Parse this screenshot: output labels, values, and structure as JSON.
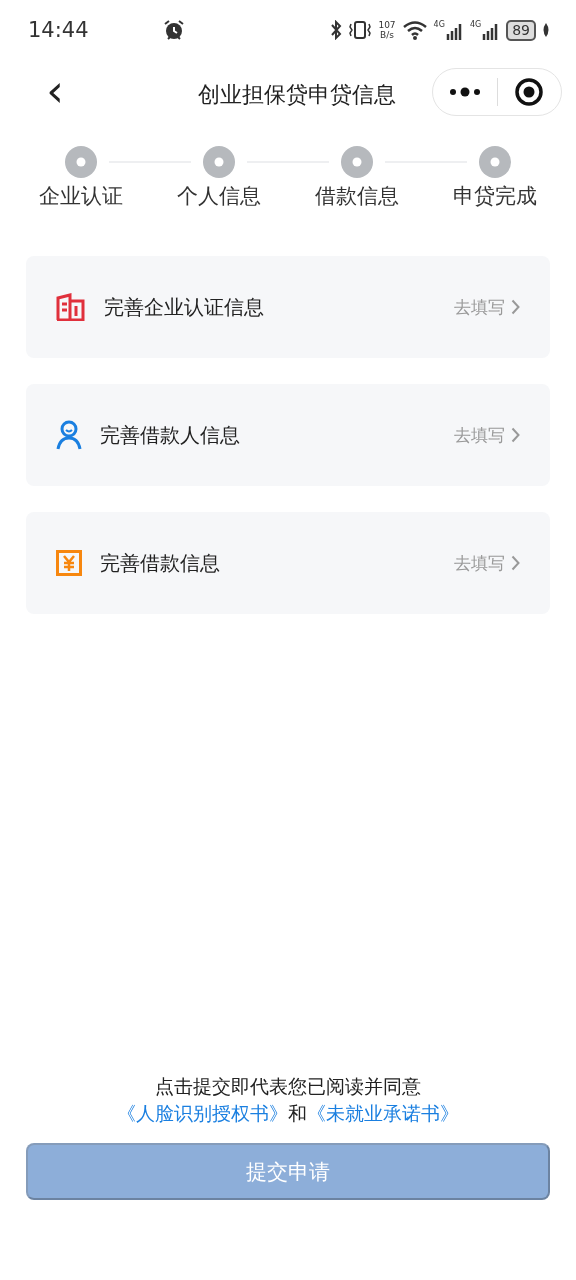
{
  "status_bar": {
    "time": "14:44",
    "net_speed_value": "107",
    "net_speed_unit": "B/s",
    "sim_1": "4G",
    "sim_2": "4G",
    "battery": "89"
  },
  "header": {
    "back": "‹",
    "title": "创业担保贷申贷信息"
  },
  "steps": [
    {
      "label": "企业认证"
    },
    {
      "label": "个人信息"
    },
    {
      "label": "借款信息"
    },
    {
      "label": "申贷完成"
    }
  ],
  "cards": [
    {
      "kind": "building",
      "title": "完善企业认证信息",
      "action": "去填写"
    },
    {
      "kind": "person",
      "title": "完善借款人信息",
      "action": "去填写"
    },
    {
      "kind": "yuan",
      "title": "完善借款信息",
      "action": "去填写"
    }
  ],
  "agreement": {
    "text": "点击提交即代表您已阅读并同意",
    "link_1": "《人脸识别授权书》",
    "joiner": "和",
    "link_2": "《未就业承诺书》"
  },
  "submit": {
    "label": "提交申请",
    "disabled": true
  }
}
